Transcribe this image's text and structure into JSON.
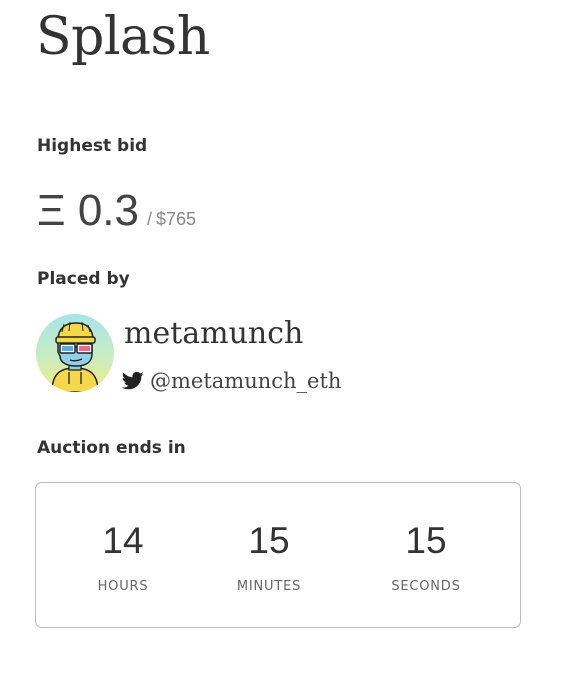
{
  "title": "Splash",
  "highest_bid": {
    "label": "Highest bid",
    "eth": "Ξ 0.3",
    "separator": "/",
    "usd": "$765"
  },
  "placed_by": {
    "label": "Placed by",
    "name": "metamunch",
    "handle": "@metamunch_eth",
    "avatar_icon": "cartoon-avatar-with-3d-glasses",
    "handle_icon": "twitter-icon"
  },
  "auction": {
    "label": "Auction ends in",
    "hours": {
      "value": "14",
      "label": "HOURS"
    },
    "minutes": {
      "value": "15",
      "label": "MINUTES"
    },
    "seconds": {
      "value": "15",
      "label": "SECONDS"
    }
  },
  "colors": {
    "text": "#333333",
    "muted": "#888888",
    "border": "#bcbcbc",
    "avatar_bg_top": "#a8e4ea",
    "avatar_bg_bottom": "#f2ec84"
  }
}
